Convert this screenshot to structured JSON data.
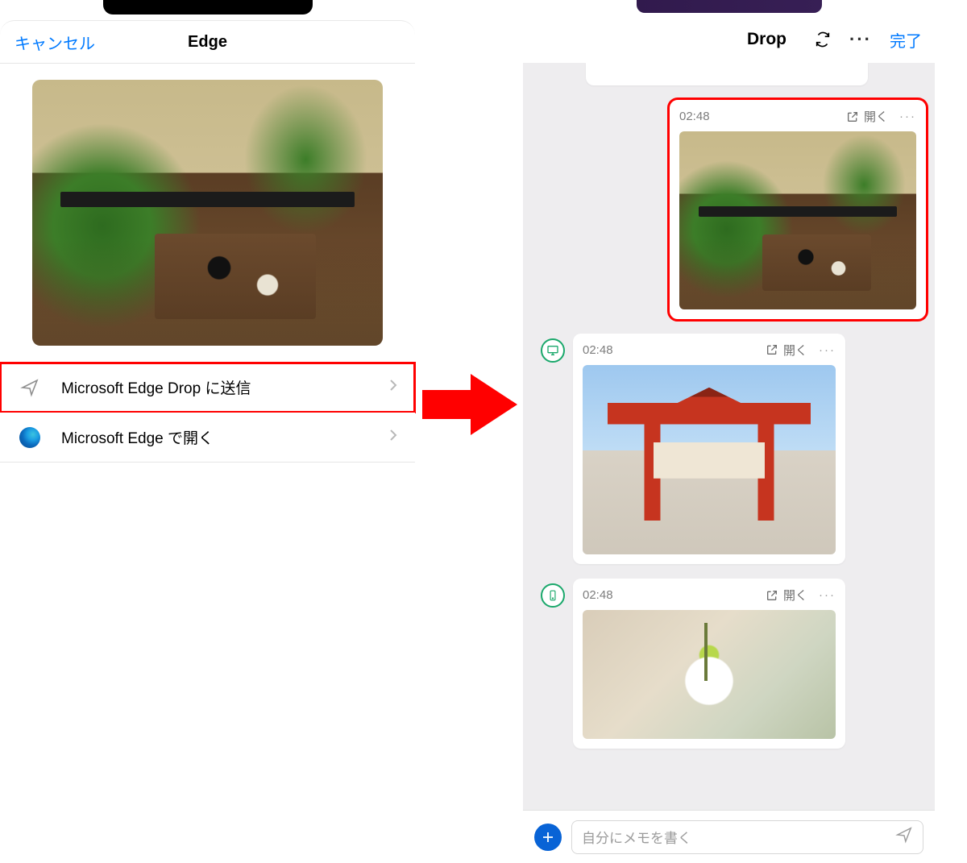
{
  "left": {
    "cancel": "キャンセル",
    "title": "Edge",
    "actions": [
      {
        "label": "Microsoft Edge Drop に送信",
        "icon": "send-icon",
        "highlight": true
      },
      {
        "label": "Microsoft Edge で開く",
        "icon": "edge-icon",
        "highlight": false
      }
    ]
  },
  "right": {
    "title": "Drop",
    "done": "完了",
    "messages": [
      {
        "time": "02:48",
        "open": "開く",
        "side": "right",
        "device": null,
        "highlight": true,
        "scene": "cafe"
      },
      {
        "time": "02:48",
        "open": "開く",
        "side": "left",
        "device": "desktop",
        "highlight": false,
        "scene": "torii"
      },
      {
        "time": "02:48",
        "open": "開く",
        "side": "left",
        "device": "mobile",
        "highlight": false,
        "scene": "flower"
      }
    ],
    "compose_placeholder": "自分にメモを書く"
  }
}
